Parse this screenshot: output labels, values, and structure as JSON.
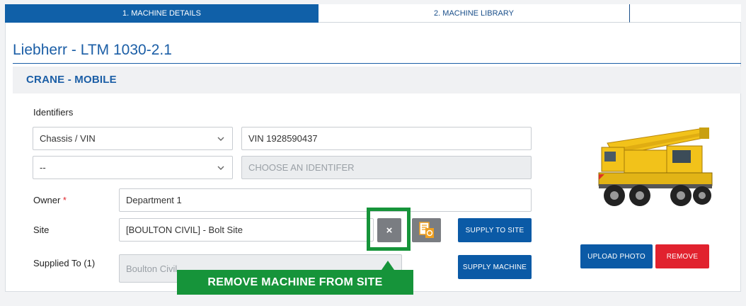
{
  "tabs": [
    {
      "label": "1. MACHINE DETAILS",
      "active": true
    },
    {
      "label": "2. MACHINE LIBRARY",
      "active": false
    }
  ],
  "machine": {
    "title": "Liebherr - LTM 1030-2.1",
    "category": "CRANE - MOBILE"
  },
  "identifiers": {
    "label": "Identifiers",
    "rows": [
      {
        "type_selected": "Chassis / VIN",
        "value": "VIN 1928590437",
        "placeholder": ""
      },
      {
        "type_selected": "--",
        "value": "",
        "placeholder": "CHOOSE AN IDENTIFER"
      }
    ]
  },
  "owner": {
    "label": "Owner",
    "required_mark": "*",
    "value": "Department 1"
  },
  "site": {
    "label": "Site",
    "value": "[BOULTON CIVIL] - Bolt Site"
  },
  "supplied_to": {
    "label": "Supplied To (1)",
    "value": "Boulton Civil"
  },
  "buttons": {
    "remove_from_site_icon": "×",
    "supply_to_site": "SUPPLY TO SITE",
    "supply_machine": "SUPPLY MACHINE",
    "upload_photo": "UPLOAD PHOTO",
    "remove": "REMOVE"
  },
  "callout": {
    "text": "REMOVE MACHINE FROM SITE"
  },
  "icons": [
    "chevron-down-icon",
    "close-icon",
    "document-refresh-icon"
  ],
  "colors": {
    "primary": "#0b5aa6",
    "danger": "#e1222e",
    "highlight": "#16943a"
  }
}
